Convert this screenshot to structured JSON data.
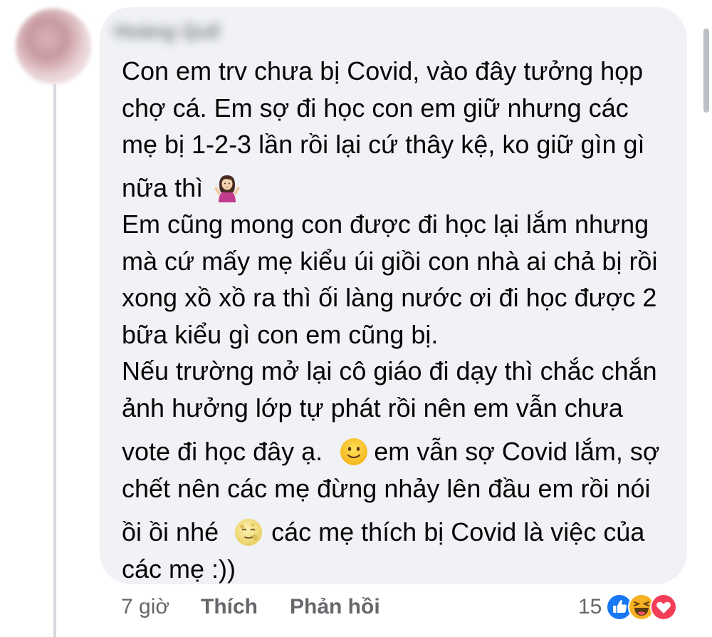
{
  "comment": {
    "author_name": "Hoàng Quế",
    "lines": [
      "Con em trv chưa bị Covid, vào đây tưởng họp",
      "chợ cá. Em sợ đi học con em giữ nhưng các",
      "mẹ bị 1-2-3 lần rồi lại cứ thây kệ, ko giữ gìn gì",
      "nữa thì",
      "Em cũng mong con được đi học lại lắm nhưng",
      "mà cứ mấy mẹ kiểu úi giồi con nhà ai chả bị rồi",
      "xong xồ xồ ra thì ối làng nước ơi đi học được 2",
      "bữa kiểu gì con em cũng bị.",
      "Nếu trường mở lại cô giáo đi dạy thì chắc chắn",
      "ảnh hưởng lớp tự phát rồi nên em vẫn chưa",
      "vote đi học đây ạ.",
      "em vẫn sợ Covid lắm, sợ",
      "chết nên các mẹ đừng nhảy lên đầu em rồi nói",
      "ồi ồi nhé",
      "các mẹ thích bị Covid là việc của",
      "các mẹ :))"
    ],
    "emojis": {
      "shrug": "woman-shrugging-emoji",
      "smile": "slightly-smiling-face-emoji",
      "moon": "full-moon-face-emoji"
    }
  },
  "footer": {
    "time": "7 giờ",
    "like_label": "Thích",
    "reply_label": "Phản hồi"
  },
  "reactions": {
    "count": "15",
    "icons": [
      "like-reaction-icon",
      "haha-reaction-icon",
      "love-reaction-icon"
    ],
    "colors": {
      "like": "#1877f2",
      "haha": "#f7b125",
      "love": "#f33e58"
    }
  },
  "colors": {
    "bubble": "#f0f2f5",
    "text": "#050505",
    "meta": "#65676b",
    "thread_line": "#d8dadf"
  }
}
